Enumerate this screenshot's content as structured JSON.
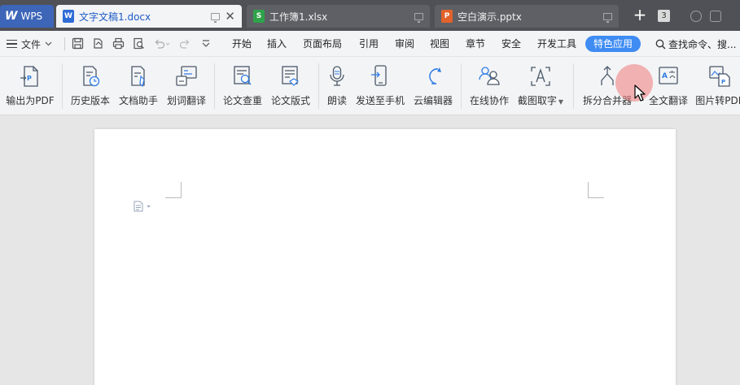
{
  "app": {
    "name": "WPS"
  },
  "tabs": [
    {
      "label": "文字文稿1.docx",
      "type": "w",
      "type_letter": "W",
      "active": true
    },
    {
      "label": "工作簿1.xlsx",
      "type": "s",
      "type_letter": "S",
      "active": false
    },
    {
      "label": "空白演示.pptx",
      "type": "p",
      "type_letter": "P",
      "active": false
    }
  ],
  "tabbar": {
    "new_tab": "+",
    "window_count": "3"
  },
  "menubar": {
    "file": "文件",
    "items": [
      "开始",
      "插入",
      "页面布局",
      "引用",
      "审阅",
      "视图",
      "章节",
      "安全",
      "开发工具"
    ],
    "special": "特色应用",
    "search": "查找命令、搜..."
  },
  "ribbon": {
    "buttons": [
      {
        "id": "export-pdf",
        "label": "输出为PDF",
        "icon": "pdf-export-icon"
      },
      {
        "id": "history",
        "label": "历史版本",
        "icon": "history-version-icon"
      },
      {
        "id": "doc-assistant",
        "label": "文档助手",
        "icon": "document-assistant-icon"
      },
      {
        "id": "word-translate",
        "label": "划词翻译",
        "icon": "word-translate-icon"
      },
      {
        "id": "paper-check",
        "label": "论文查重",
        "icon": "paper-check-icon"
      },
      {
        "id": "paper-format",
        "label": "论文版式",
        "icon": "paper-format-icon"
      },
      {
        "id": "read-aloud",
        "label": "朗读",
        "icon": "microphone-icon"
      },
      {
        "id": "send-phone",
        "label": "发送至手机",
        "icon": "send-to-phone-icon"
      },
      {
        "id": "cloud-editor",
        "label": "云编辑器",
        "icon": "cloud-editor-icon"
      },
      {
        "id": "online-collab",
        "label": "在线协作",
        "icon": "online-collaboration-icon"
      },
      {
        "id": "ocr",
        "label": "截图取字",
        "icon": "screenshot-ocr-icon"
      },
      {
        "id": "split-merge",
        "label": "拆分合并器",
        "icon": "split-merge-icon"
      },
      {
        "id": "full-translate",
        "label": "全文翻译",
        "icon": "full-translate-icon"
      },
      {
        "id": "image-to-pdf",
        "label": "图片转PDF",
        "icon": "image-to-pdf-icon"
      }
    ]
  },
  "colors": {
    "tabbar_bg": "#4f5156",
    "accent": "#3f8cf3",
    "active_tab_text": "#1e5bc6"
  }
}
